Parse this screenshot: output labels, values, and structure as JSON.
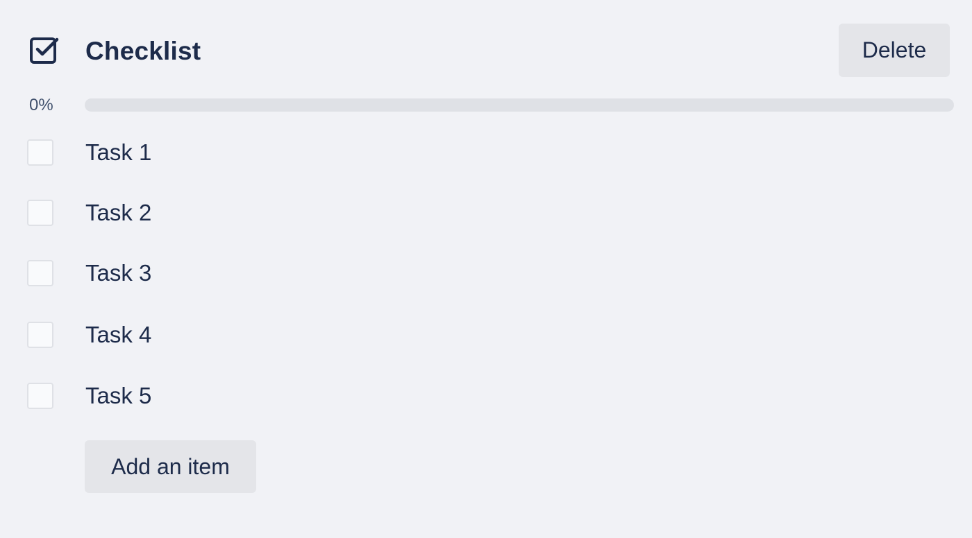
{
  "checklist": {
    "title": "Checklist",
    "delete_label": "Delete",
    "progress_label": "0%",
    "progress_fraction": 0,
    "items": [
      {
        "label": "Task 1",
        "checked": false
      },
      {
        "label": "Task 2",
        "checked": false
      },
      {
        "label": "Task 3",
        "checked": false
      },
      {
        "label": "Task 4",
        "checked": false
      },
      {
        "label": "Task 5",
        "checked": false
      }
    ],
    "add_item_label": "Add an item"
  },
  "icons": {
    "header": "checkbox-checked-icon"
  },
  "colors": {
    "background": "#f1f2f6",
    "text": "#1d2b4a",
    "button_bg": "#e4e5e9",
    "progress_track": "#dfe1e6",
    "progress_fill": "#61bd4f"
  }
}
